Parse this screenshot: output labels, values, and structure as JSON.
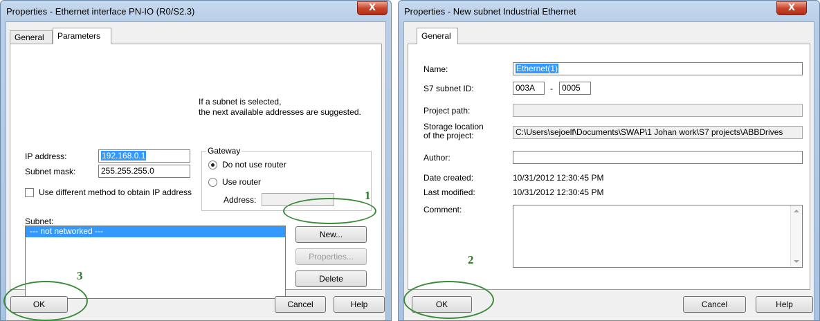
{
  "left_dialog": {
    "title": "Properties - Ethernet interface  PN-IO (R0/S2.3)",
    "close_glyph": "X",
    "tabs": [
      {
        "label": "General"
      },
      {
        "label": "Parameters"
      }
    ],
    "hint": {
      "line1": "If a subnet is selected,",
      "line2": "the next available addresses are suggested."
    },
    "ip_address": {
      "label": "IP address:",
      "value": "192.168.0.1"
    },
    "subnet_mask": {
      "label": "Subnet mask:",
      "value": "255.255.255.0"
    },
    "different_method": {
      "label": "Use different method to obtain IP address",
      "checked": false
    },
    "gateway": {
      "title": "Gateway",
      "no_router_label": "Do not use router",
      "use_router_label": "Use router",
      "selected": "Do not use router",
      "address_label": "Address:",
      "address_value": ""
    },
    "subnet": {
      "label": "Subnet:",
      "items": [
        "--- not networked ---"
      ]
    },
    "buttons": {
      "new": "New...",
      "properties": "Properties...",
      "delete": "Delete",
      "ok": "OK",
      "cancel": "Cancel",
      "help": "Help"
    },
    "annotations": {
      "one": "1",
      "three": "3"
    }
  },
  "right_dialog": {
    "title": "Properties -  New subnet Industrial Ethernet",
    "close_glyph": "X",
    "tabs": [
      {
        "label": "General"
      }
    ],
    "name": {
      "label": "Name:",
      "value": "Ethernet(1)"
    },
    "s7_subnet_id": {
      "label": "S7 subnet ID:",
      "part1": "003A",
      "separator": "-",
      "part2": "0005"
    },
    "project_path": {
      "label": "Project path:",
      "value": ""
    },
    "storage_location": {
      "label_line1": "Storage location",
      "label_line2": "of the project:",
      "value": "C:\\Users\\sejoelf\\Documents\\SWAP\\1 Johan work\\S7 projects\\ABBDrives"
    },
    "author": {
      "label": "Author:",
      "value": ""
    },
    "date_created": {
      "label": "Date created:",
      "value": "10/31/2012 12:30:45 PM"
    },
    "last_modified": {
      "label": "Last modified:",
      "value": "10/31/2012 12:30:45 PM"
    },
    "comment": {
      "label": "Comment:",
      "value": ""
    },
    "buttons": {
      "ok": "OK",
      "cancel": "Cancel",
      "help": "Help"
    },
    "annotations": {
      "two": "2"
    }
  },
  "colors": {
    "selection": "#3399ff",
    "annotation": "#2a7a2a",
    "close_button": "#c8452b"
  }
}
